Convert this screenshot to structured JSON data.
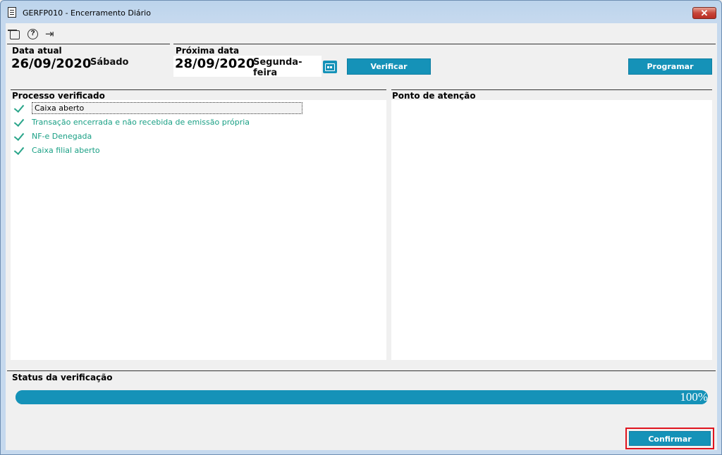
{
  "window": {
    "title": "GERFP010 - Encerramento Diário",
    "close_label": "✕"
  },
  "toolbar": {
    "icons": [
      "calendar-icon",
      "help-icon",
      "exit-icon"
    ],
    "help_glyph": "?",
    "exit_glyph": "⇥"
  },
  "current": {
    "label": "Data atual",
    "date": "26/09/2020",
    "weekday": "Sábado"
  },
  "next": {
    "label": "Próxima data",
    "date": "28/09/2020",
    "weekday": "Segunda-feira"
  },
  "buttons": {
    "verify": "Verificar",
    "schedule": "Programar",
    "confirm": "Confirmar"
  },
  "processes": {
    "header": "Processo verificado",
    "items": [
      {
        "label": "Caixa aberto",
        "status": "checked",
        "selected": true
      },
      {
        "label": "Transação encerrada e não recebida de emissão própria",
        "status": "checked",
        "selected": false
      },
      {
        "label": "NF-e Denegada",
        "status": "checked",
        "selected": false
      },
      {
        "label": "Caixa filial aberto",
        "status": "checked",
        "selected": false
      }
    ]
  },
  "attention": {
    "header": "Ponto de atenção"
  },
  "status": {
    "header": "Status da verificação",
    "progress": 1.0,
    "progress_label": "100%"
  },
  "colors": {
    "accent": "#1592b8",
    "check": "#2aa58a",
    "highlight_border": "#e0141e"
  }
}
